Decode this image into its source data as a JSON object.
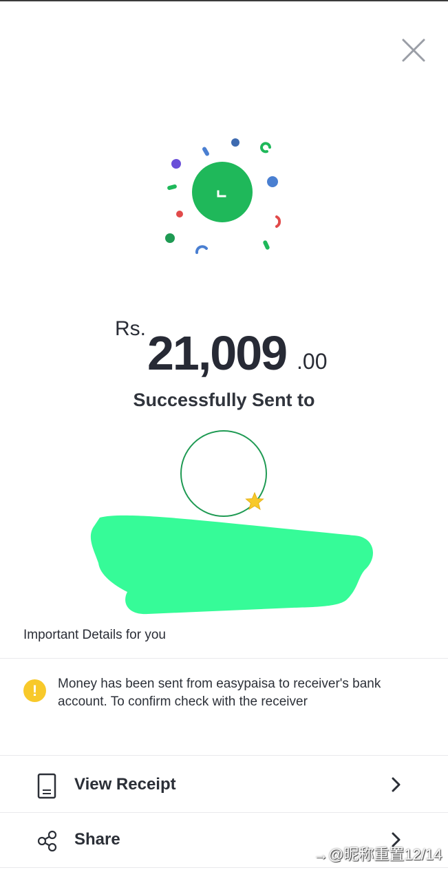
{
  "screen": {
    "close_icon": "close-icon",
    "success_icon": "checkmark-icon",
    "amount": {
      "currency": "Rs.",
      "whole": "21,009",
      "decimal": ".00"
    },
    "sent_to_label": "Successfully Sent to",
    "recipient_badge_icon": "star-icon",
    "details_title": "Important Details for you",
    "notice": {
      "icon": "warning-icon",
      "icon_glyph": "!",
      "text": "Money has been sent from easypaisa to receiver's bank account. To confirm check with the receiver"
    },
    "actions": [
      {
        "label": "View Receipt",
        "icon": "receipt-icon"
      },
      {
        "label": "Share",
        "icon": "share-icon"
      }
    ],
    "watermark": "→@昵称重置12/14"
  },
  "colors": {
    "success_green": "#1fb85a",
    "confetti_blue": "#4a7fd1",
    "confetti_purple": "#6a4fd8",
    "confetti_red": "#e14a4a",
    "warning_yellow": "#f8c92a",
    "star_yellow": "#f8c92a",
    "redaction_green": "#36fb98"
  }
}
